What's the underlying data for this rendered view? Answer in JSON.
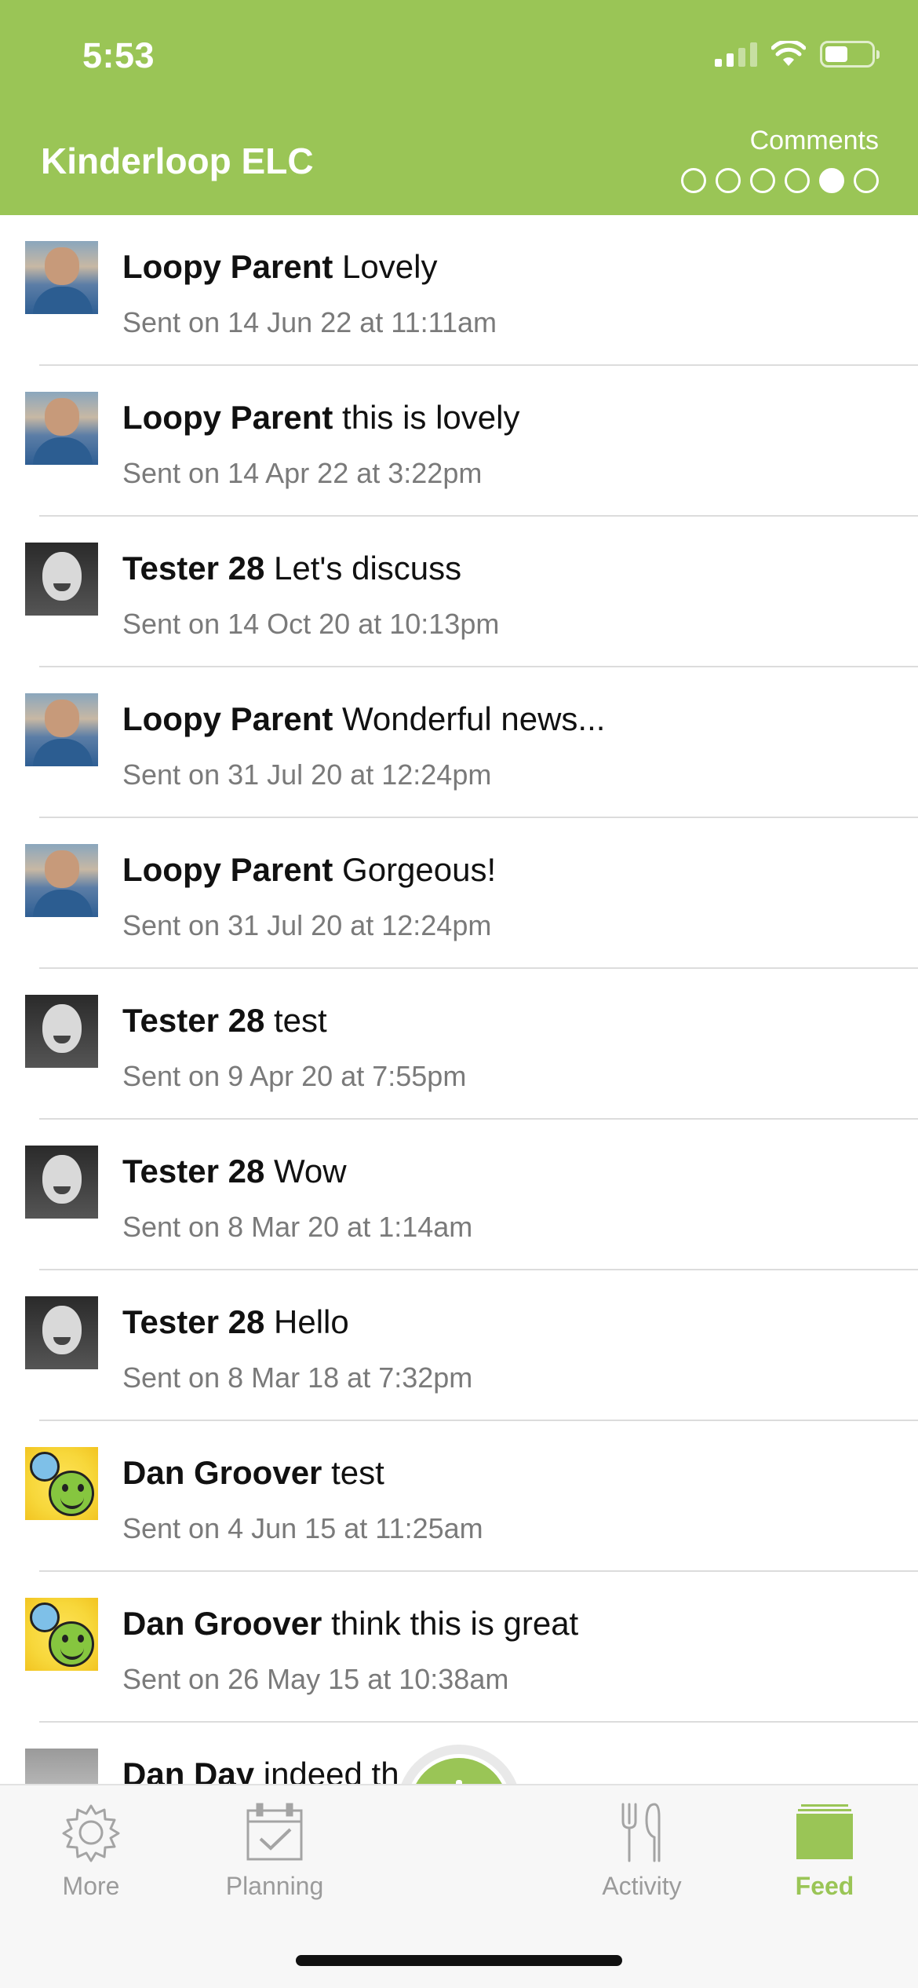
{
  "status_bar": {
    "time": "5:53"
  },
  "header": {
    "title": "Kinderloop ELC",
    "section_label": "Comments",
    "page_dots": [
      false,
      false,
      false,
      false,
      true,
      false
    ]
  },
  "comments": [
    {
      "avatar": "loopy-parent-photo",
      "name": "Loopy Parent",
      "text": "Lovely",
      "sent": "Sent on 14 Jun 22 at 11:11am"
    },
    {
      "avatar": "loopy-parent-photo",
      "name": "Loopy Parent",
      "text": "this is lovely",
      "sent": "Sent on 14 Apr 22 at 3:22pm"
    },
    {
      "avatar": "tester-28-photo",
      "name": "Tester 28",
      "text": "Let's discuss",
      "sent": "Sent on 14 Oct 20 at 10:13pm"
    },
    {
      "avatar": "loopy-parent-photo",
      "name": "Loopy Parent",
      "text": "Wonderful news...",
      "sent": "Sent on 31 Jul 20 at 12:24pm"
    },
    {
      "avatar": "loopy-parent-photo",
      "name": "Loopy Parent",
      "text": "Gorgeous!",
      "sent": "Sent on 31 Jul 20 at 12:24pm"
    },
    {
      "avatar": "tester-28-photo",
      "name": "Tester 28",
      "text": "test",
      "sent": "Sent on 9 Apr 20 at 7:55pm"
    },
    {
      "avatar": "tester-28-photo",
      "name": "Tester 28",
      "text": "Wow",
      "sent": "Sent on 8 Mar 20 at 1:14am"
    },
    {
      "avatar": "tester-28-photo",
      "name": "Tester 28",
      "text": "Hello",
      "sent": "Sent on 8 Mar 18 at 7:32pm"
    },
    {
      "avatar": "smiley-avatar",
      "name": "Dan Groover",
      "text": "test",
      "sent": "Sent on 4 Jun 15 at 11:25am"
    },
    {
      "avatar": "smiley-avatar",
      "name": "Dan Groover",
      "text": "think this is great",
      "sent": "Sent on 26 May 15 at 10:38am"
    },
    {
      "avatar": "baby-photo",
      "name": "Dan Day",
      "text": "indeed th",
      "sent": ""
    }
  ],
  "tabbar": {
    "more": "More",
    "planning": "Planning",
    "activity": "Activity",
    "feed": "Feed",
    "active": "feed",
    "accent_color": "#9ac556"
  },
  "icons": {
    "more": "gear-icon",
    "planning": "calendar-check-icon",
    "add": "plus-icon",
    "activity": "fork-knife-icon",
    "feed": "stack-icon"
  }
}
